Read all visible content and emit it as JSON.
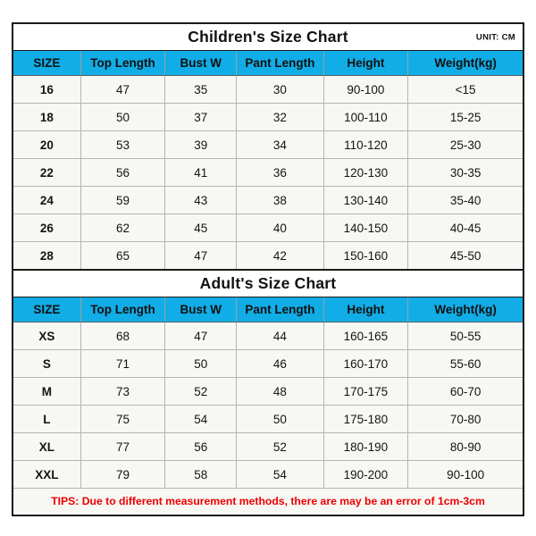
{
  "columns": [
    "SIZE",
    "Top Length",
    "Bust W",
    "Pant Length",
    "Height",
    "Weight(kg)"
  ],
  "colors": {
    "header_blue": "#11ADE6",
    "cell_background": "#F7F7F4",
    "border_dark": "#1a1a1a",
    "border_light": "#b5b5b2",
    "tips_red": "#ED0000",
    "text": "#141414"
  },
  "children": {
    "title": "Children's Size Chart",
    "unit": "UNIT: CM",
    "headers": [
      "SIZE",
      "Top Length",
      "Bust W",
      "Pant Length",
      "Height",
      "Weight(kg)"
    ],
    "rows": [
      [
        "16",
        "47",
        "35",
        "30",
        "90-100",
        "<15"
      ],
      [
        "18",
        "50",
        "37",
        "32",
        "100-110",
        "15-25"
      ],
      [
        "20",
        "53",
        "39",
        "34",
        "110-120",
        "25-30"
      ],
      [
        "22",
        "56",
        "41",
        "36",
        "120-130",
        "30-35"
      ],
      [
        "24",
        "59",
        "43",
        "38",
        "130-140",
        "35-40"
      ],
      [
        "26",
        "62",
        "45",
        "40",
        "140-150",
        "40-45"
      ],
      [
        "28",
        "65",
        "47",
        "42",
        "150-160",
        "45-50"
      ]
    ]
  },
  "adult": {
    "title": "Adult's Size Chart",
    "unit": "",
    "headers": [
      "SIZE",
      "Top Length",
      "Bust W",
      "Pant Length",
      "Height",
      "Weight(kg)"
    ],
    "rows": [
      [
        "XS",
        "68",
        "47",
        "44",
        "160-165",
        "50-55"
      ],
      [
        "S",
        "71",
        "50",
        "46",
        "160-170",
        "55-60"
      ],
      [
        "M",
        "73",
        "52",
        "48",
        "170-175",
        "60-70"
      ],
      [
        "L",
        "75",
        "54",
        "50",
        "175-180",
        "70-80"
      ],
      [
        "XL",
        "77",
        "56",
        "52",
        "180-190",
        "80-90"
      ],
      [
        "XXL",
        "79",
        "58",
        "54",
        "190-200",
        "90-100"
      ]
    ]
  },
  "tips": "TIPS: Due to different measurement methods, there are may be an error of 1cm-3cm",
  "chart_data": {
    "type": "table",
    "title": "Children's and Adult's Size Chart",
    "unit": "CM",
    "categories": [
      "SIZE",
      "Top Length",
      "Bust W",
      "Pant Length",
      "Height",
      "Weight(kg)"
    ],
    "tables": [
      {
        "name": "Children's Size Chart",
        "columns": [
          "SIZE",
          "Top Length",
          "Bust W",
          "Pant Length",
          "Height",
          "Weight(kg)"
        ],
        "rows": [
          [
            "16",
            "47",
            "35",
            "30",
            "90-100",
            "<15"
          ],
          [
            "18",
            "50",
            "37",
            "32",
            "100-110",
            "15-25"
          ],
          [
            "20",
            "53",
            "39",
            "34",
            "110-120",
            "25-30"
          ],
          [
            "22",
            "56",
            "41",
            "36",
            "120-130",
            "30-35"
          ],
          [
            "24",
            "59",
            "43",
            "38",
            "130-140",
            "35-40"
          ],
          [
            "26",
            "62",
            "45",
            "40",
            "140-150",
            "40-45"
          ],
          [
            "28",
            "65",
            "47",
            "42",
            "150-160",
            "45-50"
          ]
        ]
      },
      {
        "name": "Adult's Size Chart",
        "columns": [
          "SIZE",
          "Top Length",
          "Bust W",
          "Pant Length",
          "Height",
          "Weight(kg)"
        ],
        "rows": [
          [
            "XS",
            "68",
            "47",
            "44",
            "160-165",
            "50-55"
          ],
          [
            "S",
            "71",
            "50",
            "46",
            "160-170",
            "55-60"
          ],
          [
            "M",
            "73",
            "52",
            "48",
            "170-175",
            "60-70"
          ],
          [
            "L",
            "75",
            "54",
            "50",
            "175-180",
            "70-80"
          ],
          [
            "XL",
            "77",
            "56",
            "52",
            "180-190",
            "80-90"
          ],
          [
            "XXL",
            "79",
            "58",
            "54",
            "190-200",
            "90-100"
          ]
        ]
      }
    ],
    "annotations": [
      "TIPS: Due to different measurement methods, there are may be an error of 1cm-3cm"
    ]
  }
}
